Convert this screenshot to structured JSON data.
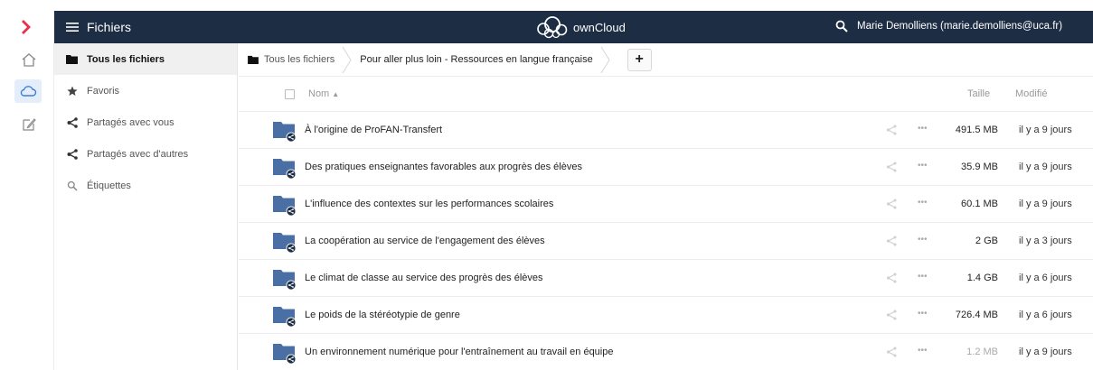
{
  "header": {
    "app_title": "Fichiers",
    "brand": "ownCloud",
    "user": "Marie Demolliens (marie.demolliens@uca.fr)",
    "bg_color": "#1d2d44"
  },
  "rail": {
    "items": [
      {
        "icon": "home-icon"
      },
      {
        "icon": "cloud-icon"
      },
      {
        "icon": "edit-icon"
      }
    ]
  },
  "nav": {
    "items": [
      {
        "label": "Tous les fichiers",
        "icon": "folder-icon",
        "active": true
      },
      {
        "label": "Favoris",
        "icon": "star-icon"
      },
      {
        "label": "Partagés avec vous",
        "icon": "share-icon"
      },
      {
        "label": "Partagés avec d'autres",
        "icon": "share-icon"
      },
      {
        "label": "Étiquettes",
        "icon": "tag-icon"
      }
    ]
  },
  "breadcrumb": {
    "home": "Tous les fichiers",
    "current": "Pour aller plus loin - Ressources en langue française",
    "add_label": "+"
  },
  "table": {
    "col_name": "Nom",
    "col_size": "Taille",
    "col_modified": "Modifié",
    "rows": [
      {
        "name": "À l'origine de ProFAN-Transfert",
        "size": "491.5 MB",
        "modified": "il y a 9 jours"
      },
      {
        "name": "Des pratiques enseignantes favorables aux progrès des élèves",
        "size": "35.9 MB",
        "modified": "il y a 9 jours"
      },
      {
        "name": "L'influence des contextes sur les performances scolaires",
        "size": "60.1 MB",
        "modified": "il y a 9 jours"
      },
      {
        "name": "La coopération au service de l'engagement des élèves",
        "size": "2 GB",
        "modified": "il y a 3 jours"
      },
      {
        "name": "Le climat de classe au service des progrès des élèves",
        "size": "1.4 GB",
        "modified": "il y a 6 jours"
      },
      {
        "name": "Le poids de la stéréotypie de genre",
        "size": "726.4 MB",
        "modified": "il y a 6 jours"
      },
      {
        "name": "Un environnement numérique pour l'entraînement au travail en équipe",
        "size": "1.2 MB",
        "modified": "il y a 9 jours"
      }
    ],
    "folder_color": "#4a6fa5",
    "more_label": "•••"
  }
}
